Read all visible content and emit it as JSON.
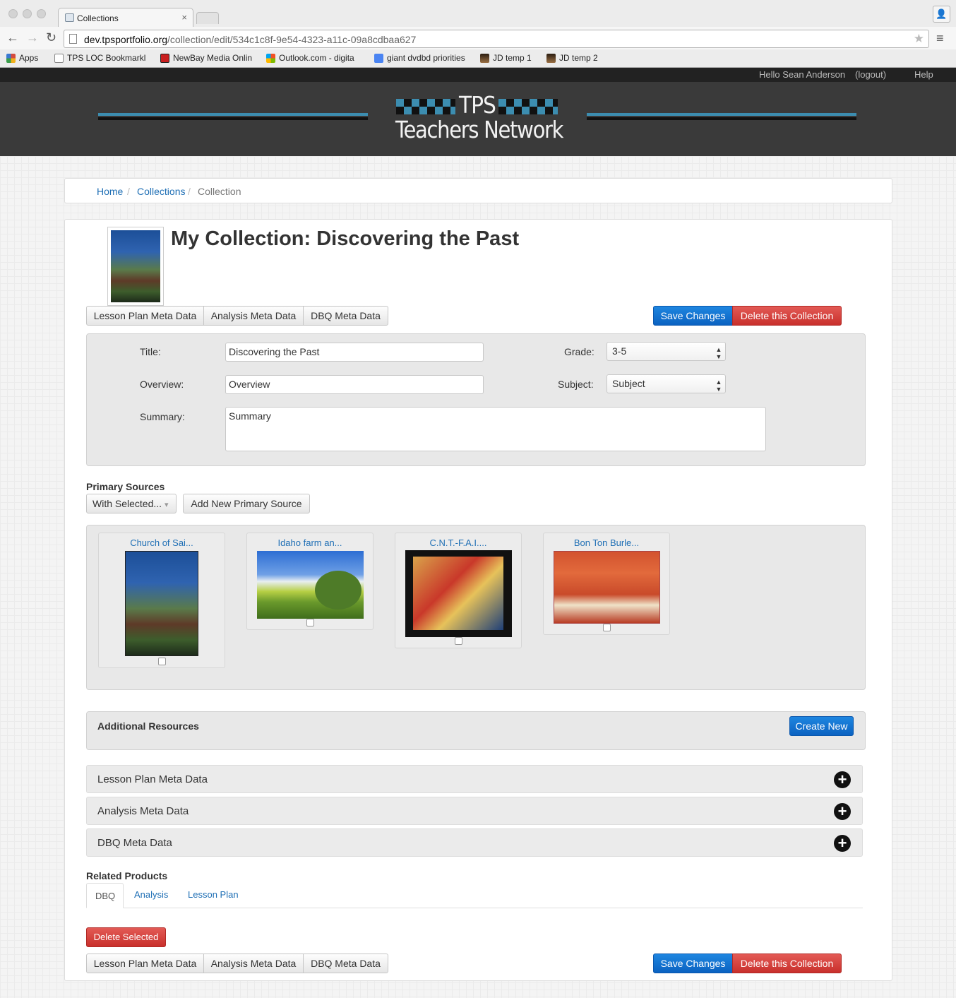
{
  "browser": {
    "tab_title": "Collections",
    "tab_close": "×",
    "url_host": "dev.tpsportfolio.org",
    "url_path": "/collection/edit/534c1c8f-9e54-4323-a11c-09a8cdbaa627",
    "nav_back": "←",
    "nav_forward": "→",
    "nav_reload": "↻",
    "star": "★",
    "menu": "≡",
    "profile": "👤",
    "bookmarks": [
      {
        "label": "Apps",
        "icon": "apps-grid-icon",
        "color": "#d54b3d"
      },
      {
        "label": "TPS LOC Bookmarkl",
        "icon": "page-icon",
        "color": "#ffffff"
      },
      {
        "label": "NewBay Media Onlin",
        "icon": "newbay-w-icon",
        "color": "#c91f1f"
      },
      {
        "label": "Outlook.com - digita",
        "icon": "windows-logo-icon",
        "color": "#1e7be6"
      },
      {
        "label": "giant dvdbd priorities",
        "icon": "google-g-icon",
        "color": "#4a84f2"
      },
      {
        "label": "JD temp 1",
        "icon": "portrait-thumb-icon",
        "color": "#6a4e2b"
      },
      {
        "label": "JD temp 2",
        "icon": "portrait-thumb-icon",
        "color": "#6a4e2b"
      }
    ]
  },
  "site": {
    "greeting": "Hello Sean Anderson",
    "logout": "(logout)",
    "help": "Help",
    "logo_line1": "TPS",
    "logo_line2": "Teachers Network",
    "brand_blue": "#3c8db0"
  },
  "breadcrumb": {
    "home": "Home",
    "collections": "Collections",
    "current": "Collection",
    "separator": "/"
  },
  "page": {
    "title": "My Collection: Discovering the Past"
  },
  "tabs_top": [
    "Lesson Plan Meta Data",
    "Analysis Meta Data",
    "DBQ Meta Data"
  ],
  "actions": {
    "save": "Save Changes",
    "delete": "Delete this Collection"
  },
  "form": {
    "title_label": "Title:",
    "title_value": "Discovering the Past",
    "overview_label": "Overview:",
    "overview_placeholder": "Overview",
    "summary_label": "Summary:",
    "summary_placeholder": "Summary",
    "grade_label": "Grade:",
    "grade_value": "3-5",
    "subject_label": "Subject:",
    "subject_value": "Subject",
    "select_arrows": "▲▼"
  },
  "primary_sources": {
    "heading": "Primary Sources",
    "with_selected": "With Selected...",
    "caret": "▾",
    "add_new": "Add New Primary Source",
    "items": [
      {
        "title": "Church of Sai...",
        "image": "church-photo"
      },
      {
        "title": "Idaho farm an...",
        "image": "farm-landscape-photo"
      },
      {
        "title": "C.N.T.-F.A.I....",
        "image": "cnt-fai-poster"
      },
      {
        "title": "Bon Ton Burle...",
        "image": "bon-ton-poster"
      }
    ]
  },
  "additional_resources": {
    "heading": "Additional Resources",
    "create_new": "Create New"
  },
  "accordion": [
    {
      "label": "Lesson Plan Meta Data",
      "icon": "plus-circle-icon"
    },
    {
      "label": "Analysis Meta Data",
      "icon": "plus-circle-icon"
    },
    {
      "label": "DBQ Meta Data",
      "icon": "plus-circle-icon"
    }
  ],
  "plus": "+",
  "related_products": {
    "heading": "Related Products",
    "tabs": [
      "DBQ",
      "Analysis",
      "Lesson Plan"
    ],
    "active_tab": "DBQ",
    "delete_selected": "Delete Selected"
  },
  "tabs_bottom": [
    "Lesson Plan Meta Data",
    "Analysis Meta Data",
    "DBQ Meta Data"
  ]
}
